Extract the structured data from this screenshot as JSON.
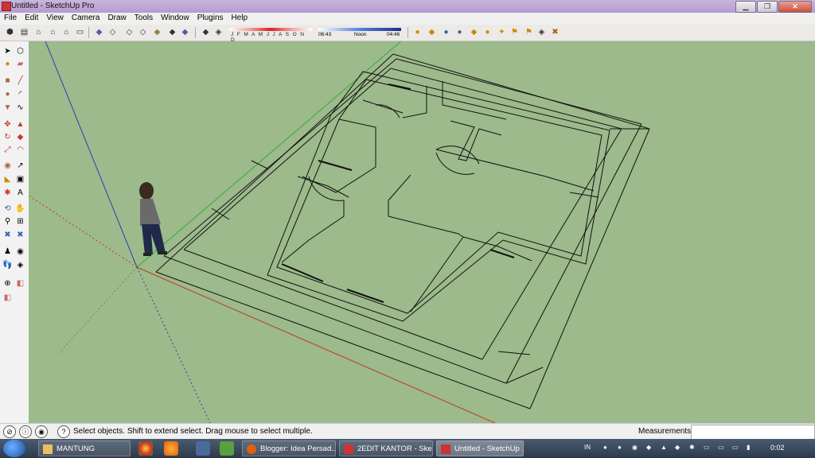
{
  "window": {
    "title": "Untitled - SketchUp Pro",
    "minimize_glyph": "▁",
    "restore_glyph": "❐",
    "close_glyph": "✕"
  },
  "menu": [
    "File",
    "Edit",
    "View",
    "Camera",
    "Draw",
    "Tools",
    "Window",
    "Plugins",
    "Help"
  ],
  "toolbar": {
    "months_label": "J F M A M J J A S O N D",
    "time_start": "06:43",
    "time_noon": "Noon",
    "time_end": "04:46"
  },
  "icons": {
    "select": "select-arrow-icon",
    "paint": "paint-bucket-icon",
    "eraser": "eraser-icon",
    "orbit": "orbit-icon",
    "pan": "pan-icon",
    "zoom": "zoom-icon"
  },
  "colors": {
    "viewport_bg": "#9cba8b",
    "axis_red": "#c0392b",
    "axis_green": "#3aaa3a",
    "axis_blue": "#2b3fb0"
  },
  "status": {
    "hint": "Select objects. Shift to extend select. Drag mouse to select multiple.",
    "measurements_label": "Measurements",
    "measurements_value": ""
  },
  "taskbar": {
    "items": [
      "MANTUNG",
      "Blogger: Idea Persad...",
      "2EDIT KANTOR - Ske...",
      "Untitled - SketchUp ..."
    ],
    "lang": "IN",
    "clock": "0:02"
  }
}
